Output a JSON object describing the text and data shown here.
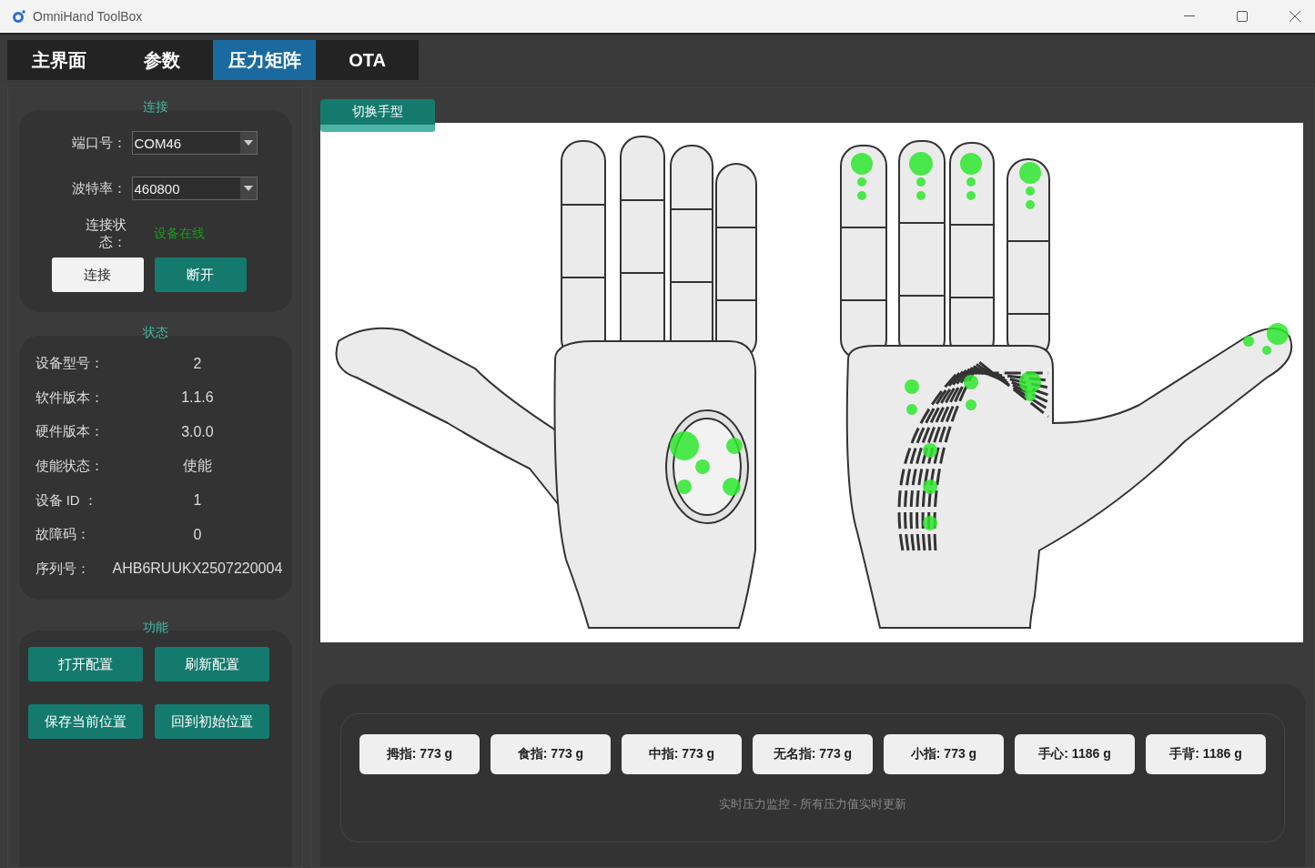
{
  "window": {
    "title": "OmniHand ToolBox"
  },
  "tabs": [
    {
      "label": "主界面",
      "selected": false
    },
    {
      "label": "参数",
      "selected": false
    },
    {
      "label": "压力矩阵",
      "selected": true
    },
    {
      "label": "OTA",
      "selected": false
    }
  ],
  "connection": {
    "title": "连接",
    "fields": [
      {
        "label": "端口号：",
        "value": "COM46"
      },
      {
        "label": "波特率：",
        "value": "460800"
      }
    ],
    "status_label": "连接状态：",
    "status_value": "设备在线",
    "buttons": [
      {
        "label": "连接",
        "kind": "light"
      },
      {
        "label": "断开",
        "kind": "teal"
      }
    ]
  },
  "status": {
    "title": "状态",
    "rows": [
      {
        "label": "设备型号：",
        "value": "2"
      },
      {
        "label": "软件版本：",
        "value": "1.1.6"
      },
      {
        "label": "硬件版本：",
        "value": "3.0.0"
      },
      {
        "label": "使能状态：",
        "value": "使能"
      },
      {
        "label": "设备 ID ：",
        "value": "1"
      },
      {
        "label": "故障码：",
        "value": "0"
      },
      {
        "label": "序列号：",
        "value": "AHB6RUUKX2507220004"
      }
    ]
  },
  "functions": {
    "title": "功能",
    "buttons": [
      "打开配置",
      "刷新配置",
      "保存当前位置",
      "回到初始位置"
    ]
  },
  "pressure": {
    "switch_button": "切换手型",
    "readings": [
      "拇指: 773 g",
      "食指: 773 g",
      "中指: 773 g",
      "无名指: 773 g",
      "小指: 773 g",
      "手心: 1186 g",
      "手背: 1186 g"
    ],
    "note": "实时压力监控 - 所有压力值实时更新"
  }
}
